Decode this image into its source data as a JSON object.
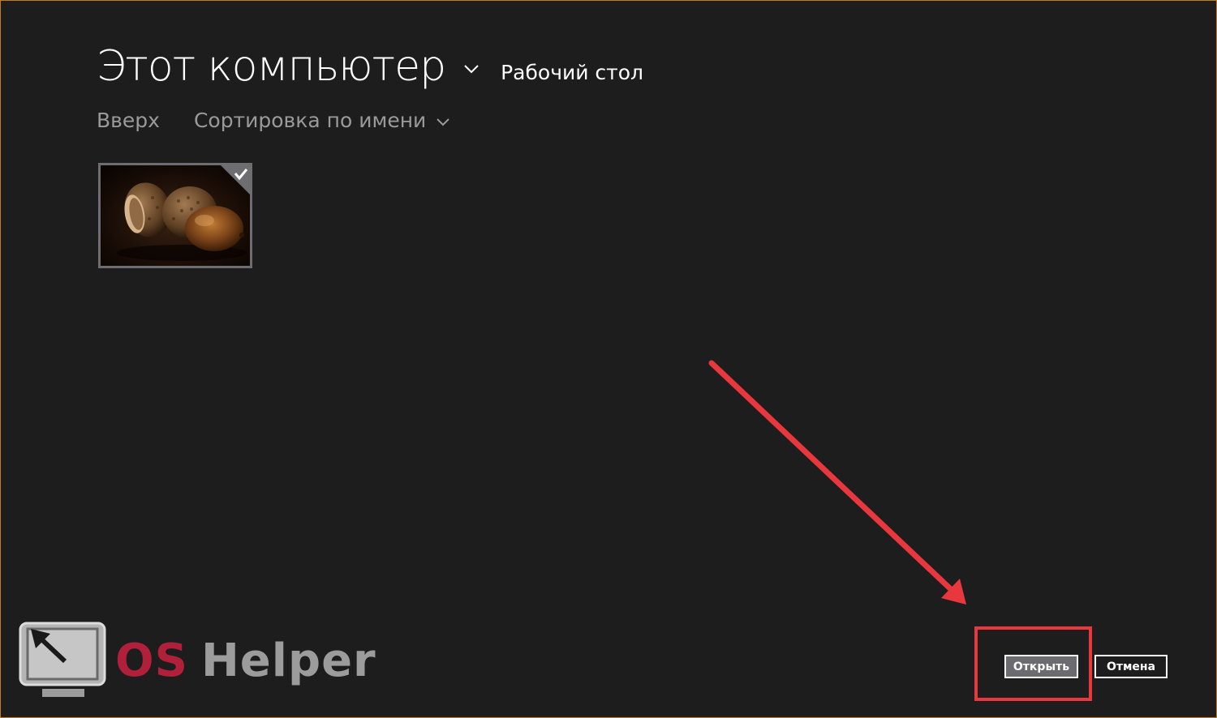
{
  "header": {
    "location_title": "Этот компьютер",
    "subfolder": "Рабочий стол"
  },
  "toolbar": {
    "up_label": "Вверх",
    "sort_label": "Сортировка по имени"
  },
  "files": [
    {
      "thumbnail": "acorn-photo",
      "selected": true
    }
  ],
  "actions": {
    "open_label": "Открыть",
    "cancel_label": "Отмена"
  },
  "watermark": {
    "logo_icon": "monitor-cursor-icon",
    "text_os": "OS",
    "text_helper": "Helper"
  },
  "colors": {
    "background": "#1d1d1d",
    "annotation_red": "#e8383d",
    "logo_red": "#b0203a",
    "logo_gray": "#9c9c9c"
  }
}
